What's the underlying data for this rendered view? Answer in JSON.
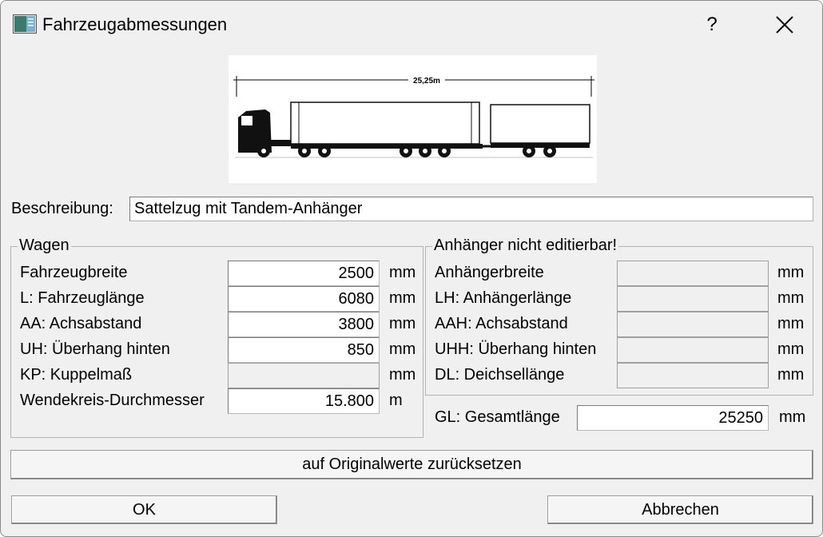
{
  "window": {
    "title": "Fahrzeugabmessungen",
    "help_label": "?",
    "icons": {
      "app": "app-window-icon",
      "close": "close-icon"
    }
  },
  "image": {
    "dimension_label": "25,25m",
    "subject": "truck-with-trailer-icon"
  },
  "description": {
    "label": "Beschreibung:",
    "value": "Sattelzug mit Tandem-Anhänger"
  },
  "wagen": {
    "title": "Wagen",
    "rows": [
      {
        "label": "Fahrzeugbreite",
        "value": "2500",
        "unit": "mm",
        "enabled": true
      },
      {
        "label": "L: Fahrzeuglänge",
        "value": "6080",
        "unit": "mm",
        "enabled": true
      },
      {
        "label": "AA: Achsabstand",
        "value": "3800",
        "unit": "mm",
        "enabled": true
      },
      {
        "label": "UH: Überhang hinten",
        "value": "850",
        "unit": "mm",
        "enabled": true
      },
      {
        "label": "KP: Kuppelmaß",
        "value": "",
        "unit": "mm",
        "enabled": false
      },
      {
        "label": "Wendekreis-Durchmesser",
        "value": "15.800",
        "unit": "m",
        "enabled": true
      }
    ]
  },
  "anhaenger": {
    "title": "Anhänger nicht editierbar!",
    "rows": [
      {
        "label": "Anhängerbreite",
        "value": "",
        "unit": "mm"
      },
      {
        "label": "LH: Anhängerlänge",
        "value": "",
        "unit": "mm"
      },
      {
        "label": "AAH: Achsabstand",
        "value": "",
        "unit": "mm"
      },
      {
        "label": "UHH: Überhang hinten",
        "value": "",
        "unit": "mm"
      },
      {
        "label": "DL: Deichsellänge",
        "value": "",
        "unit": "mm"
      }
    ]
  },
  "gesamt": {
    "label": "GL: Gesamtlänge",
    "value": "25250",
    "unit": "mm"
  },
  "buttons": {
    "reset": "auf Originalwerte zurücksetzen",
    "ok": "OK",
    "cancel": "Abbrechen"
  }
}
